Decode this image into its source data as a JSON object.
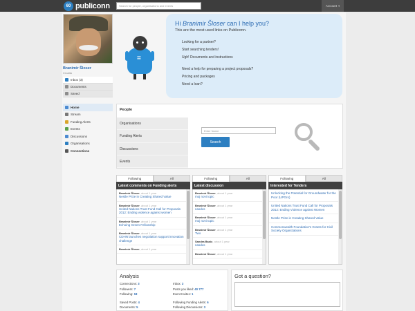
{
  "topbar": {
    "logo_badge": "60",
    "logo_text": "publiconn",
    "search_placeholder": "Search for people, organisations and events",
    "account_label": "Account",
    "account_caret": "▾"
  },
  "profile": {
    "name": "Branimir Šloser",
    "country": "Croatia"
  },
  "menu_top": [
    {
      "label": "Inbox (3)",
      "icon": "inbox-icon",
      "color": "#2d7fc1"
    },
    {
      "label": "Documents",
      "icon": "documents-icon",
      "color": "#8c8c8c"
    },
    {
      "label": "Saved",
      "icon": "saved-icon",
      "color": "#8c8c8c"
    }
  ],
  "menu_nav": [
    {
      "label": "Home",
      "icon": "home-icon",
      "color": "#4b8ad1"
    },
    {
      "label": "Stream",
      "icon": "stream-icon",
      "color": "#777"
    },
    {
      "label": "Funding Alerts",
      "icon": "funding-alerts-icon",
      "color": "#d9a52a"
    },
    {
      "label": "Events",
      "icon": "events-icon",
      "color": "#5aa14b"
    },
    {
      "label": "Discussions",
      "icon": "discussions-icon",
      "color": "#4b8ad1"
    },
    {
      "label": "Organisations",
      "icon": "organisations-icon",
      "color": "#2d7fc1"
    },
    {
      "label": "Connections",
      "icon": "connections-icon",
      "color": "#555"
    }
  ],
  "hero": {
    "greeting_prefix": "Hi ",
    "greeting_name": "Branimir Šloser",
    "greeting_suffix": " can I help you?",
    "subtitle": "This are the most used links on Publiconn.",
    "links_group1": [
      "Looking for a partner?",
      "Start searching tenders!",
      "Ugh! Documents and instructions"
    ],
    "links_group2": [
      "Need a help for preparing a project proposals?",
      "Pricing and packages",
      "Need a loan?"
    ]
  },
  "people": {
    "title": "People",
    "tabs": [
      "Organisations",
      "Funding Alerts",
      "Discussions",
      "Events"
    ],
    "input_placeholder": "Enter Name",
    "search_button": "Search"
  },
  "columns": [
    {
      "tabs": [
        "Following",
        "All"
      ],
      "header": "Latest comments on Funding alerts",
      "items": [
        {
          "author": "Branimir Šloser",
          "time": ", about 1 year",
          "text": "Nestle Prize in Creating Shared Value"
        },
        {
          "author": "Branimir Šloser",
          "time": ", about 1 year",
          "text": "United Nations Trust Fund Call for Proposals 2012: Ending violence against women"
        },
        {
          "author": "Branimir Šloser",
          "time": ", about 1 year",
          "text": "Echoing Green Fellowship"
        },
        {
          "author": "Branimir Šloser",
          "time": ", about 1 year",
          "text": "CDHN launches negotiation support innovation challenge"
        },
        {
          "author": "Branimir Šloser",
          "time": ", about 1 year",
          "text": ""
        }
      ]
    },
    {
      "tabs": [
        "Following",
        "All"
      ],
      "header": "Latest discussion",
      "items": [
        {
          "author": "Branimir Šloser",
          "time": ", about 1 year",
          "text": "moj novi topic"
        },
        {
          "author": "Branimir Šloser",
          "time": ", about 1 year",
          "text": "nasdos"
        },
        {
          "author": "Branimir Šloser",
          "time": ", about 1 year",
          "text": "moj novi topic"
        },
        {
          "author": "Branimir Šloser",
          "time": ", about 1 year",
          "text": "Two"
        },
        {
          "author": "Sandra Basic",
          "time": ", about 1 year",
          "text": "nasdos"
        },
        {
          "author": "Branimir Šloser",
          "time": ", about 1 year",
          "text": ""
        }
      ]
    },
    {
      "tabs": [
        "Following",
        "All"
      ],
      "header": "Interested for Tenders",
      "items": [
        {
          "author": "",
          "time": "",
          "text": "Unlocking the Potential for Groundwater for the Poor (UPGro)"
        },
        {
          "author": "",
          "time": "",
          "text": "United Nations Trust Fund Call for Proposals 2012: Ending Violence against Women"
        },
        {
          "author": "",
          "time": "",
          "text": "Nestle Prize in Creating Shared Value"
        },
        {
          "author": "",
          "time": "",
          "text": "Commonwealth Foundation's Grants for Civil Society Organizations"
        }
      ]
    }
  ],
  "analysis": {
    "title": "Analysis",
    "rows": [
      [
        {
          "label": "Connections:",
          "value": "3"
        },
        {
          "label": "Inbox:",
          "value": "3"
        }
      ],
      [
        {
          "label": "Followers:",
          "value": "7"
        },
        {
          "label": "Posts you liked:",
          "value": "40 777"
        }
      ],
      [
        {
          "label": "Following:",
          "value": "18"
        },
        {
          "label": "Event Invites:",
          "value": "1"
        }
      ]
    ],
    "rows2": [
      [
        {
          "label": "Saved Posts:",
          "value": "4"
        },
        {
          "label": "Following Funding Alerts:",
          "value": "6"
        }
      ],
      [
        {
          "label": "Documents:",
          "value": "5"
        },
        {
          "label": "Following Discussions:",
          "value": "3"
        }
      ]
    ]
  },
  "question": {
    "title": "Got a question?"
  }
}
